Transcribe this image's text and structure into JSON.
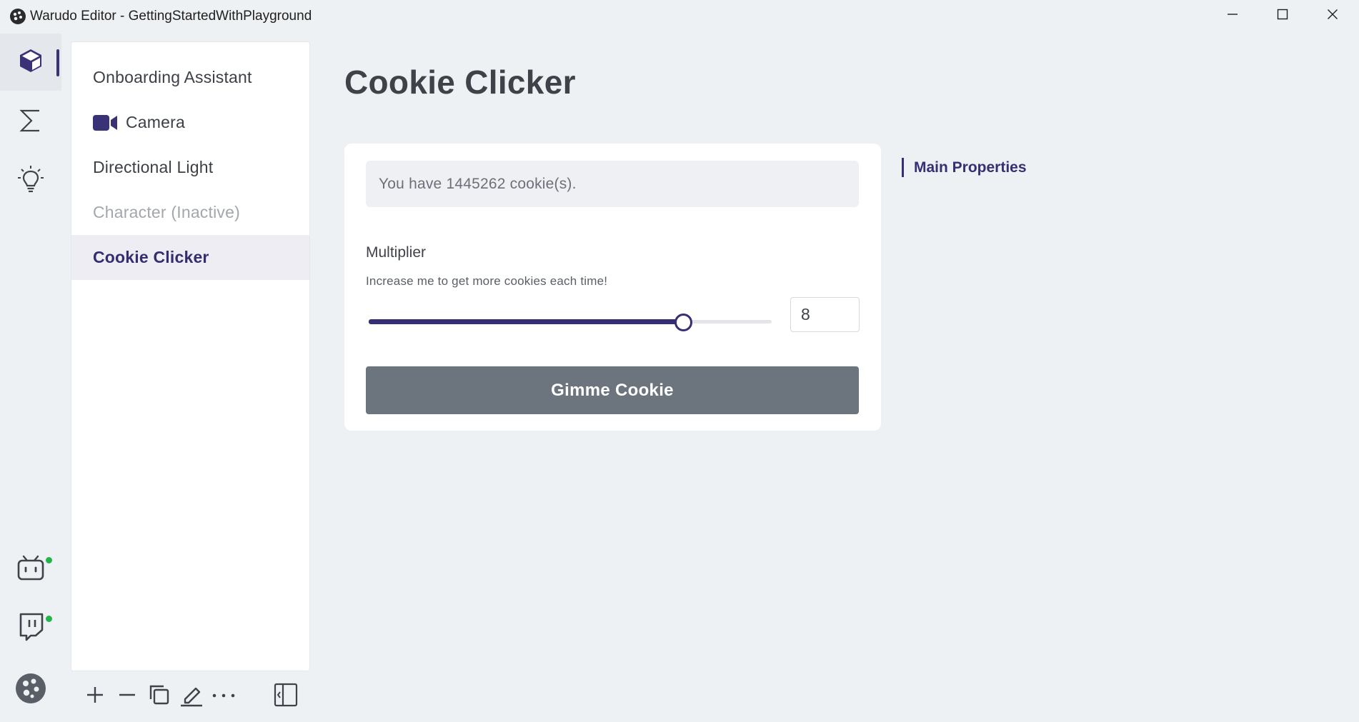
{
  "window": {
    "title": "Warudo Editor - GettingStartedWithPlayground"
  },
  "activity_bar": {
    "items": [
      {
        "icon": "cube-icon",
        "active": true
      },
      {
        "icon": "sigma-icon",
        "active": false
      },
      {
        "icon": "lightbulb-icon",
        "active": false
      }
    ],
    "bottom_items": [
      {
        "icon": "bilibili-icon",
        "online": true
      },
      {
        "icon": "twitch-icon",
        "online": true
      },
      {
        "icon": "warudo-logo-icon"
      }
    ],
    "accent_color": "#3a3277",
    "status_color": "#23b54a"
  },
  "scene": {
    "items": [
      {
        "label": "Onboarding Assistant",
        "state": "normal"
      },
      {
        "label": "Camera",
        "state": "normal",
        "icon": "camera-icon"
      },
      {
        "label": "Directional Light",
        "state": "normal"
      },
      {
        "label": "Character (Inactive)",
        "state": "inactive"
      },
      {
        "label": "Cookie Clicker",
        "state": "selected"
      }
    ],
    "toolbar": [
      "add-icon",
      "remove-icon",
      "duplicate-icon",
      "rename-icon",
      "more-icon",
      "collapse-panel-icon"
    ]
  },
  "main": {
    "title": "Cookie Clicker",
    "cookie_count_text": "You have 1445262 cookie(s).",
    "multiplier": {
      "label": "Multiplier",
      "description": "Increase me to get more cookies each time!",
      "value": "8",
      "slider_fraction": 0.78
    },
    "button_label": "Gimme Cookie",
    "section_nav": "Main Properties"
  }
}
